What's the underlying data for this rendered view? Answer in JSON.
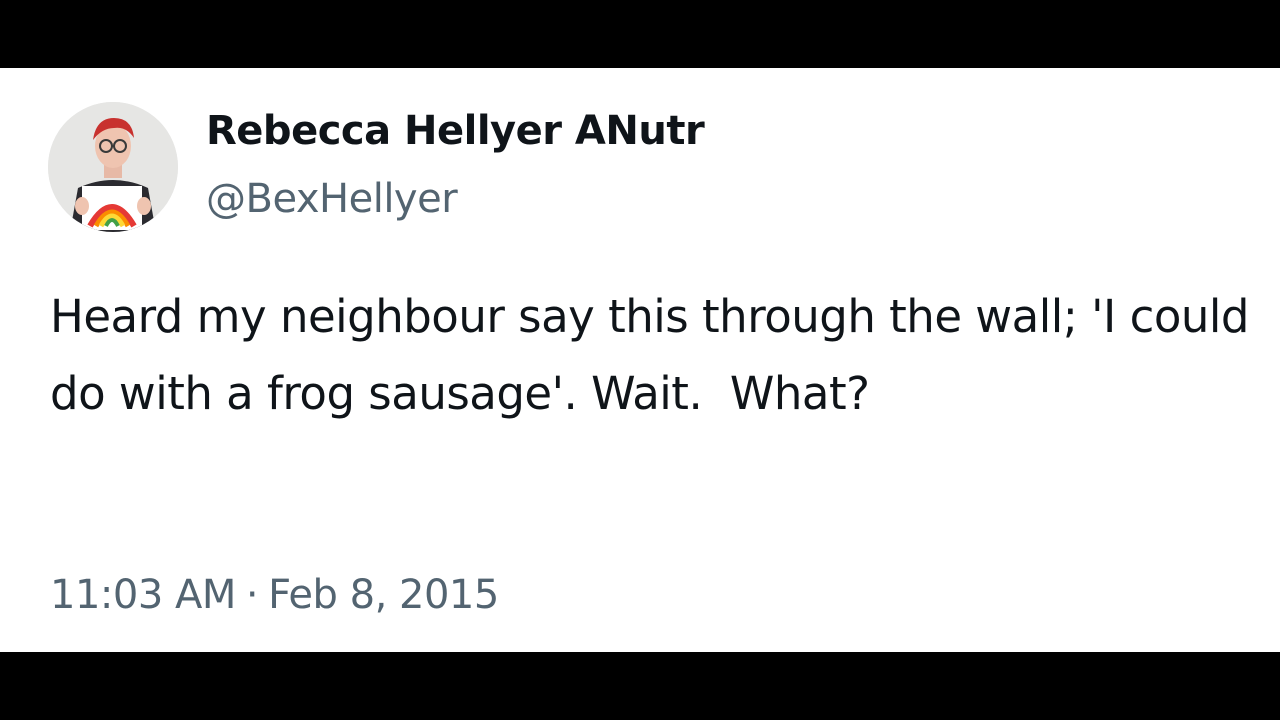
{
  "tweet": {
    "author": {
      "display_name": "Rebecca Hellyer ANutr",
      "handle": "@BexHellyer",
      "avatar_icon": "profile-photo"
    },
    "text": "Heard my neighbour say this through the wall; 'I could do with a frog sausage'. Wait.  What?",
    "time": "11:03 AM",
    "separator": "·",
    "date": "Feb 8, 2015"
  },
  "colors": {
    "primary_text": "#0f1419",
    "secondary_text": "#536471",
    "card_background": "#ffffff",
    "letterbox": "#000000"
  }
}
